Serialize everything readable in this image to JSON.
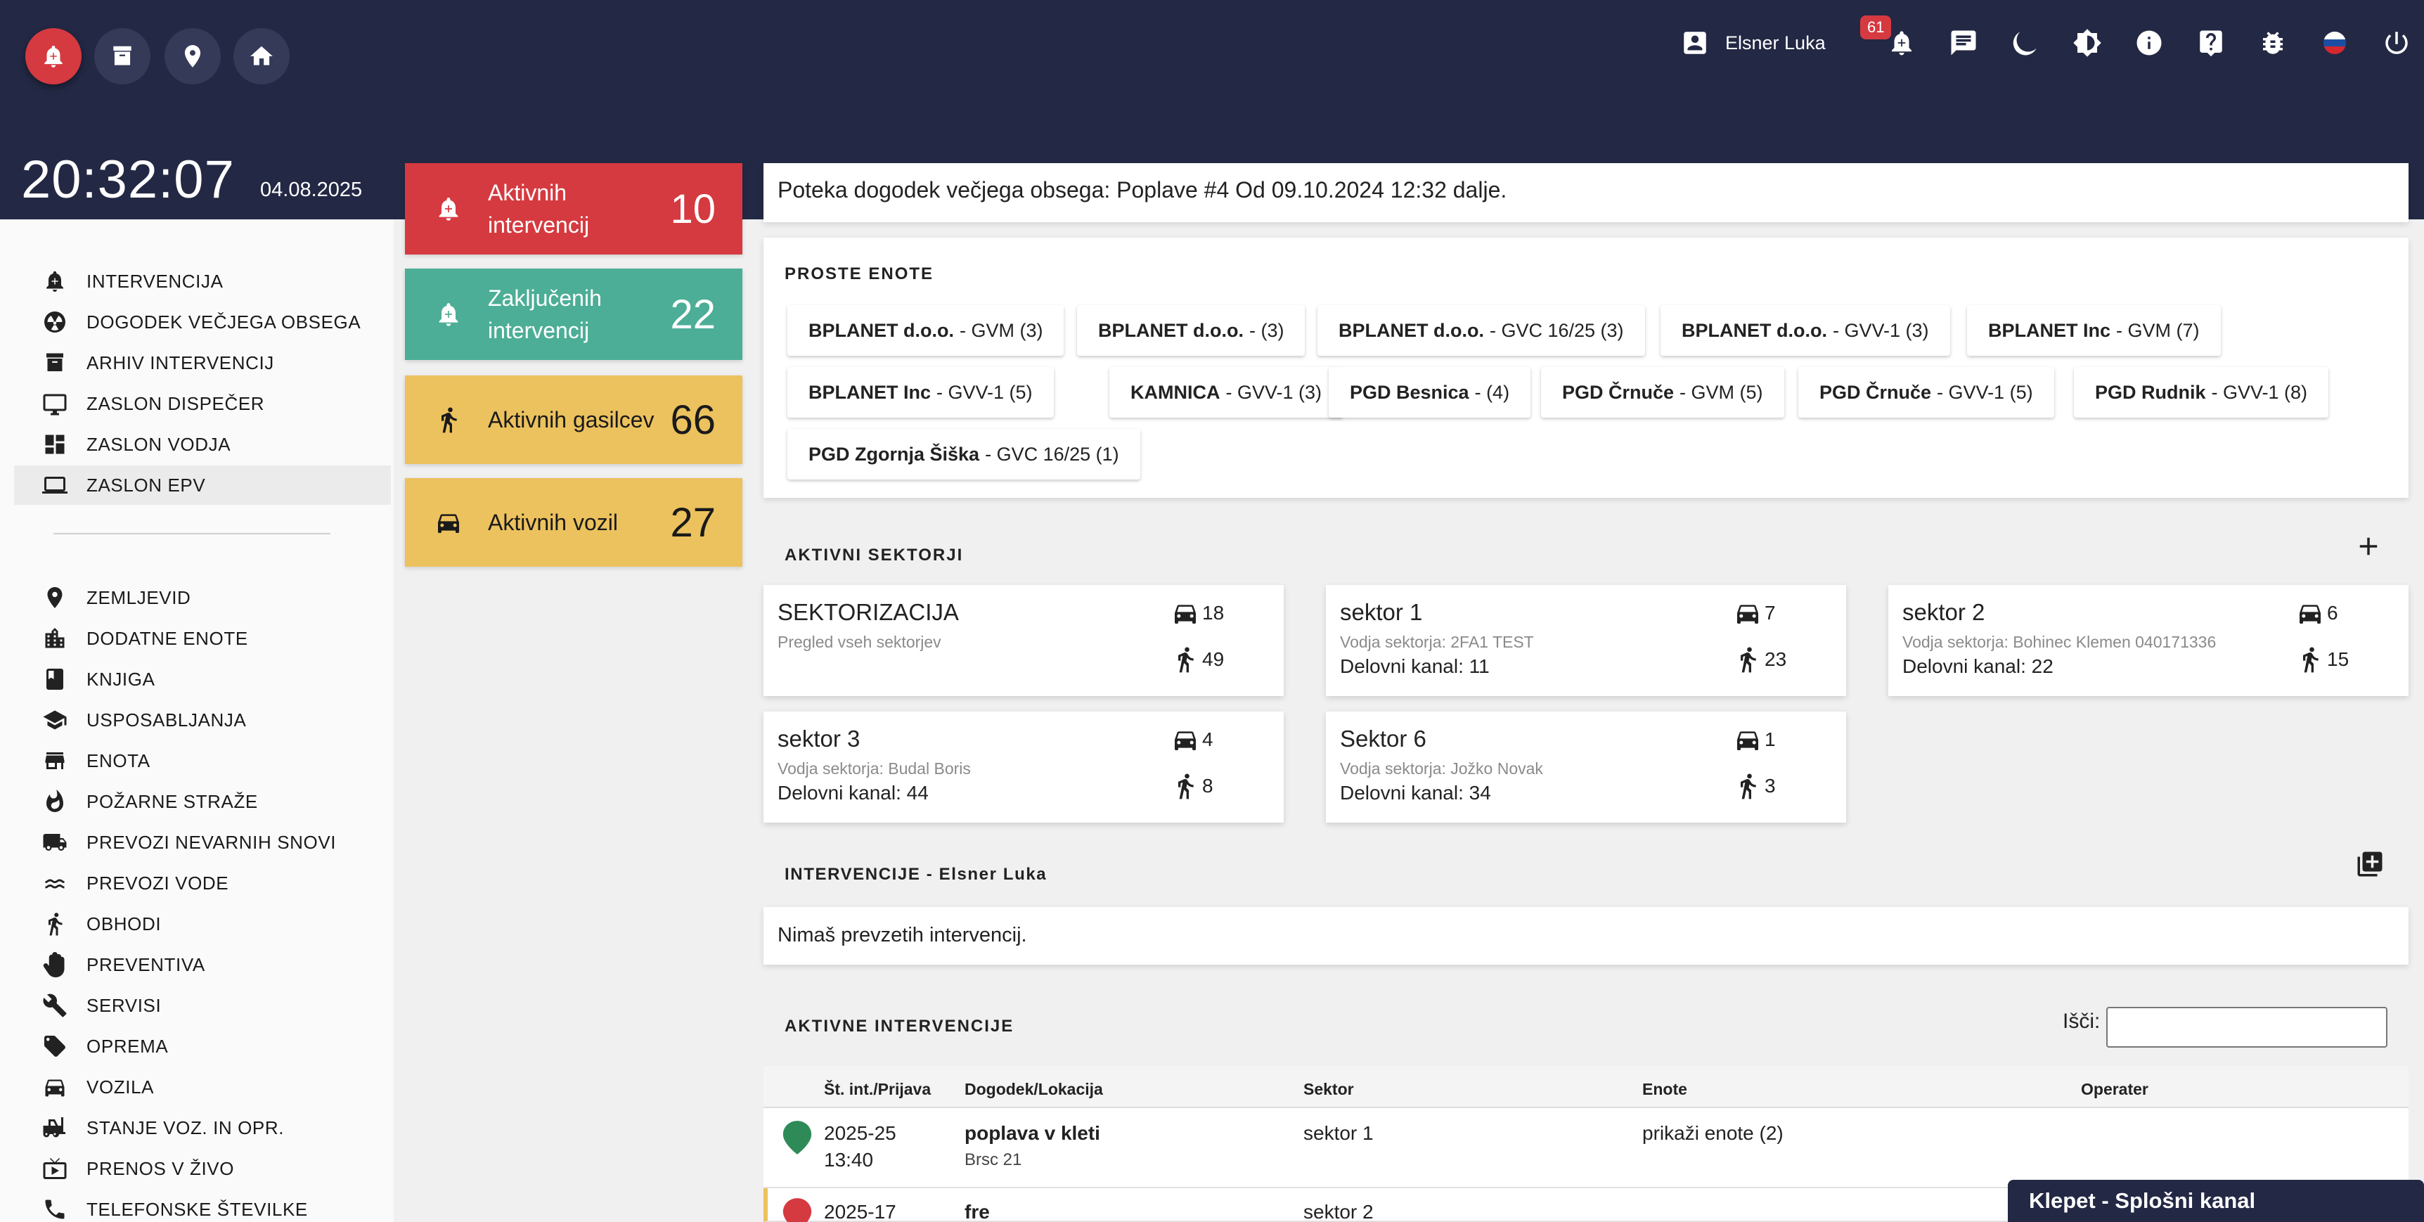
{
  "topbar": {
    "user_name": "Elsner Luka",
    "notification_count": "61",
    "accent_color": "#d53a40",
    "icons_left": [
      "new-intervention-icon",
      "archive-icon",
      "location-icon",
      "home-icon"
    ],
    "icons_right": [
      "notifications-icon",
      "chat-icon",
      "dark-mode-icon",
      "brightness-icon",
      "info-icon",
      "help-icon",
      "bug-icon",
      "language-flag-icon",
      "power-icon"
    ]
  },
  "clock": {
    "time": "20:32:07",
    "date": "04.08.2025"
  },
  "sidebar": {
    "items": [
      {
        "label": "INTERVENCIJA",
        "icon": "bell-plus-icon"
      },
      {
        "label": "DOGODEK VEČJEGA OBSEGA",
        "icon": "radioactive-icon"
      },
      {
        "label": "ARHIV INTERVENCIJ",
        "icon": "archive-icon"
      },
      {
        "label": "ZASLON DISPEČER",
        "icon": "monitor-icon"
      },
      {
        "label": "ZASLON VODJA",
        "icon": "dashboard-icon"
      },
      {
        "label": "ZASLON EPV",
        "icon": "laptop-icon"
      }
    ],
    "items2": [
      {
        "label": "ZEMLJEVID",
        "icon": "location-icon"
      },
      {
        "label": "DODATNE ENOTE",
        "icon": "building-icon"
      },
      {
        "label": "KNJIGA",
        "icon": "book-icon"
      },
      {
        "label": "USPOSABLJANJA",
        "icon": "school-icon"
      },
      {
        "label": "ENOTA",
        "icon": "store-icon"
      },
      {
        "label": "POŽARNE STRAŽE",
        "icon": "fire-icon"
      },
      {
        "label": "PREVOZI NEVARNIH SNOVI",
        "icon": "truck-hazard-icon"
      },
      {
        "label": "PREVOZI VODE",
        "icon": "water-icon"
      },
      {
        "label": "OBHODI",
        "icon": "walk-icon"
      },
      {
        "label": "PREVENTIVA",
        "icon": "hand-icon"
      },
      {
        "label": "SERVISI",
        "icon": "wrench-icon"
      },
      {
        "label": "OPREMA",
        "icon": "tag-icon"
      },
      {
        "label": "VOZILA",
        "icon": "car-icon"
      },
      {
        "label": "STANJE VOZ. IN OPR.",
        "icon": "forklift-icon"
      },
      {
        "label": "PRENOS V ŽIVO",
        "icon": "live-tv-icon"
      },
      {
        "label": "TELEFONSKE ŠTEVILKE",
        "icon": "phone-icon"
      }
    ]
  },
  "stats": [
    {
      "label": "Aktivnih intervencij",
      "value": "10",
      "color": "#d53a40",
      "icon": "bell-plus-icon"
    },
    {
      "label": "Zaključenih intervencij",
      "value": "22",
      "color": "#4cae96",
      "icon": "bell-plus-icon"
    },
    {
      "label": "Aktivnih gasilcev",
      "value": "66",
      "color": "#ecc25e",
      "icon": "walk-icon"
    },
    {
      "label": "Aktivnih vozil",
      "value": "27",
      "color": "#ecc25e",
      "icon": "car-icon"
    }
  ],
  "banner": {
    "text": "Poteka dogodek večjega obsega: Poplave #4 Od 09.10.2024 12:32 dalje."
  },
  "proste_enote": {
    "title": "PROSTE ENOTE",
    "chips": [
      {
        "bold": "BPLANET d.o.o.",
        "rest": "- GVM (3)"
      },
      {
        "bold": "BPLANET d.o.o.",
        "rest": "- (3)"
      },
      {
        "bold": "BPLANET d.o.o.",
        "rest": "- GVC 16/25 (3)"
      },
      {
        "bold": "BPLANET d.o.o.",
        "rest": "- GVV-1 (3)"
      },
      {
        "bold": "BPLANET Inc",
        "rest": "- GVM (7)"
      },
      {
        "bold": "BPLANET Inc",
        "rest": "- GVV-1 (5)"
      },
      {
        "bold": "KAMNICA",
        "rest": "- GVV-1 (3)"
      },
      {
        "bold": "PGD Besnica",
        "rest": "- (4)"
      },
      {
        "bold": "PGD Črnuče",
        "rest": "- GVM (5)"
      },
      {
        "bold": "PGD Črnuče",
        "rest": "- GVV-1 (5)"
      },
      {
        "bold": "PGD Rudnik",
        "rest": "- GVV-1 (8)"
      },
      {
        "bold": "PGD Zgornja Šiška",
        "rest": "- GVC 16/25 (1)"
      }
    ]
  },
  "sektorji": {
    "title": "AKTIVNI SEKTORJI",
    "cards": [
      {
        "title": "SEKTORIZACIJA",
        "sub": "Pregled vseh sektorjev",
        "channel": "",
        "vehicles": "18",
        "people": "49"
      },
      {
        "title": "sektor 1",
        "sub": "Vodja sektorja: 2FA1 TEST",
        "channel": "Delovni kanal: 11",
        "vehicles": "7",
        "people": "23"
      },
      {
        "title": "sektor 2",
        "sub": "Vodja sektorja: Bohinec Klemen 040171336",
        "channel": "Delovni kanal: 22",
        "vehicles": "6",
        "people": "15"
      },
      {
        "title": "sektor 3",
        "sub": "Vodja sektorja: Budal Boris",
        "channel": "Delovni kanal: 44",
        "vehicles": "4",
        "people": "8"
      },
      {
        "title": "Sektor 6",
        "sub": "Vodja sektorja: Jožko Novak",
        "channel": "Delovni kanal: 34",
        "vehicles": "1",
        "people": "3"
      }
    ]
  },
  "moje_intervencije": {
    "title": "INTERVENCIJE - Elsner Luka",
    "empty_text": "Nimaš prevzetih intervencij."
  },
  "aktivne": {
    "title": "AKTIVNE INTERVENCIJE",
    "search_label": "Išči:",
    "search_value": "",
    "columns": [
      "Št. int./Prijava",
      "Dogodek/Lokacija",
      "Sektor",
      "Enote",
      "Operater"
    ],
    "rows": [
      {
        "num": "2025-25",
        "time": "13:40",
        "event": "poplava v kleti",
        "location": "Brsc 21",
        "sector": "sektor 1",
        "units": "prikaži enote (2)",
        "pin_color": "#2e8b57"
      },
      {
        "num": "2025-17",
        "time": "",
        "event": "fre",
        "location": "",
        "sector": "sektor 2",
        "units": "",
        "pin_color": "#d53a40"
      }
    ]
  },
  "chat": {
    "label": "Klepet - Splošni kanal"
  }
}
